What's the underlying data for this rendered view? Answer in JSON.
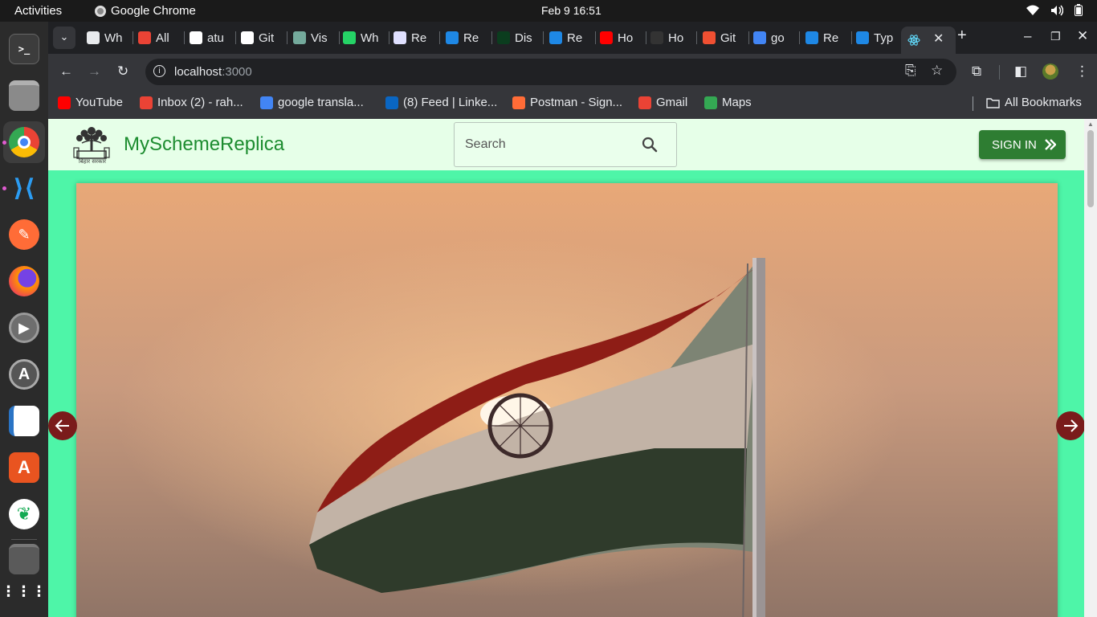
{
  "system": {
    "activities": "Activities",
    "app_name": "Google Chrome",
    "clock": "Feb 9  16:51"
  },
  "tabs": [
    {
      "label": "Wh",
      "icon": "chrome-icon",
      "color": "#e8eaed"
    },
    {
      "label": "All",
      "icon": "gmail-icon",
      "color": "#ea4335"
    },
    {
      "label": "atu",
      "icon": "github-icon",
      "color": "#ffffff"
    },
    {
      "label": "Git",
      "icon": "github-icon",
      "color": "#ffffff"
    },
    {
      "label": "Vis",
      "icon": "openai-icon",
      "color": "#74aa9c"
    },
    {
      "label": "Wh",
      "icon": "whatsapp-icon",
      "color": "#25d366"
    },
    {
      "label": "Re",
      "icon": "fs-icon",
      "color": "#e0e0ff"
    },
    {
      "label": "Re",
      "icon": "mui-icon",
      "color": "#1e88e5"
    },
    {
      "label": "Dis",
      "icon": "my-icon",
      "color": "#0b3d1e"
    },
    {
      "label": "Re",
      "icon": "mui-icon",
      "color": "#1e88e5"
    },
    {
      "label": "Ho",
      "icon": "youtube-icon",
      "color": "#ff0000"
    },
    {
      "label": "Ho",
      "icon": "em-icon",
      "color": "#333333"
    },
    {
      "label": "Git",
      "icon": "git-icon",
      "color": "#f05032"
    },
    {
      "label": "go",
      "icon": "google-icon",
      "color": "#4285f4"
    },
    {
      "label": "Re",
      "icon": "mui-icon",
      "color": "#1e88e5"
    },
    {
      "label": "Typ",
      "icon": "mui-icon",
      "color": "#1e88e5"
    }
  ],
  "active_tab": {
    "icon": "react-icon",
    "color": "#61dafb"
  },
  "address": {
    "host": "localhost",
    "port": ":3000"
  },
  "bookmarks": [
    {
      "label": "YouTube",
      "icon": "youtube-icon",
      "color": "#ff0000"
    },
    {
      "label": "Inbox (2) - rah...",
      "icon": "gmail-icon",
      "color": "#ea4335"
    },
    {
      "label": "google transla...",
      "icon": "google-icon",
      "color": "#4285f4"
    },
    {
      "label": "(8) Feed | Linke...",
      "icon": "linkedin-icon",
      "color": "#0a66c2"
    },
    {
      "label": "Postman - Sign...",
      "icon": "postman-icon",
      "color": "#ff6c37"
    },
    {
      "label": "Gmail",
      "icon": "gmail-icon",
      "color": "#ea4335"
    },
    {
      "label": "Maps",
      "icon": "maps-icon",
      "color": "#34a853"
    }
  ],
  "all_bookmarks": "All Bookmarks",
  "site": {
    "brand": "MySchemeReplica",
    "emblem_text": "बिहार सरकार",
    "search_placeholder": "Search",
    "signin_label": "SIGN IN"
  },
  "colors": {
    "page_bg": "#4ef5a8",
    "header_bg": "#e6ffe8",
    "brand_green": "#1c8c2f",
    "signin_bg": "#2e7d32",
    "arrow_bg": "#7a1b1b"
  }
}
